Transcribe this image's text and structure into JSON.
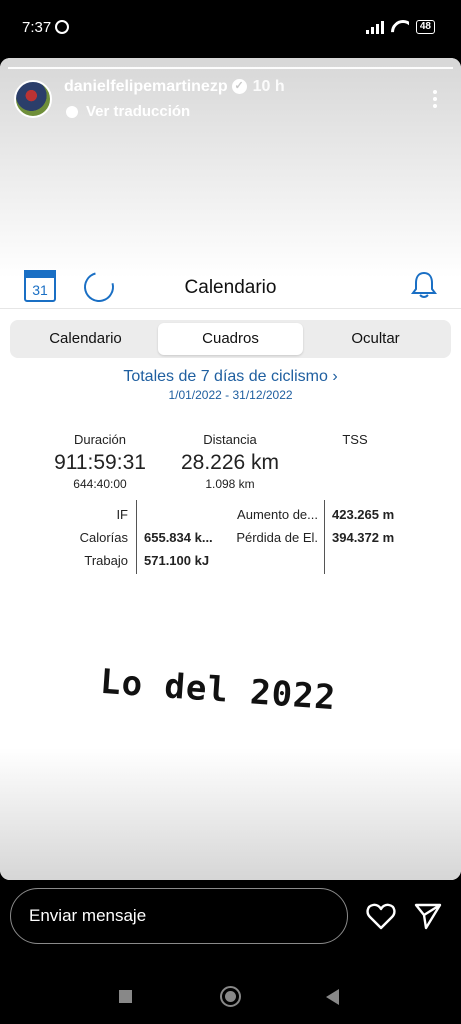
{
  "status_bar": {
    "time": "7:37",
    "battery": "48"
  },
  "story": {
    "username": "danielfelipemartinezp",
    "time_ago": "10 h",
    "translate_label": "Ver traducción",
    "overlay_text": "Lo del 2022"
  },
  "app": {
    "title": "Calendario",
    "calendar_day": "31",
    "tabs": [
      {
        "label": "Calendario",
        "active": false
      },
      {
        "label": "Cuadros",
        "active": true
      },
      {
        "label": "Ocultar",
        "active": false
      }
    ],
    "totals_title": "Totales de 7 días de ciclismo",
    "date_range": "1/01/2022 - 31/12/2022",
    "metrics": {
      "duration": {
        "label": "Duración",
        "value": "911:59:31",
        "sub": "644:40:00"
      },
      "distance": {
        "label": "Distancia",
        "value": "28.226 km",
        "sub": "1.098 km"
      },
      "tss": {
        "label": "TSS"
      }
    },
    "table": {
      "if_label": "IF",
      "calories_label": "Calorías",
      "calories_value": "655.834 k...",
      "work_label": "Trabajo",
      "work_value": "571.100 kJ",
      "elev_gain_label": "Aumento de...",
      "elev_gain_value": "423.265 m",
      "elev_loss_label": "Pérdida de El.",
      "elev_loss_value": "394.372 m"
    },
    "accent_color": "#1a6fc4"
  },
  "reply": {
    "placeholder": "Enviar mensaje"
  }
}
